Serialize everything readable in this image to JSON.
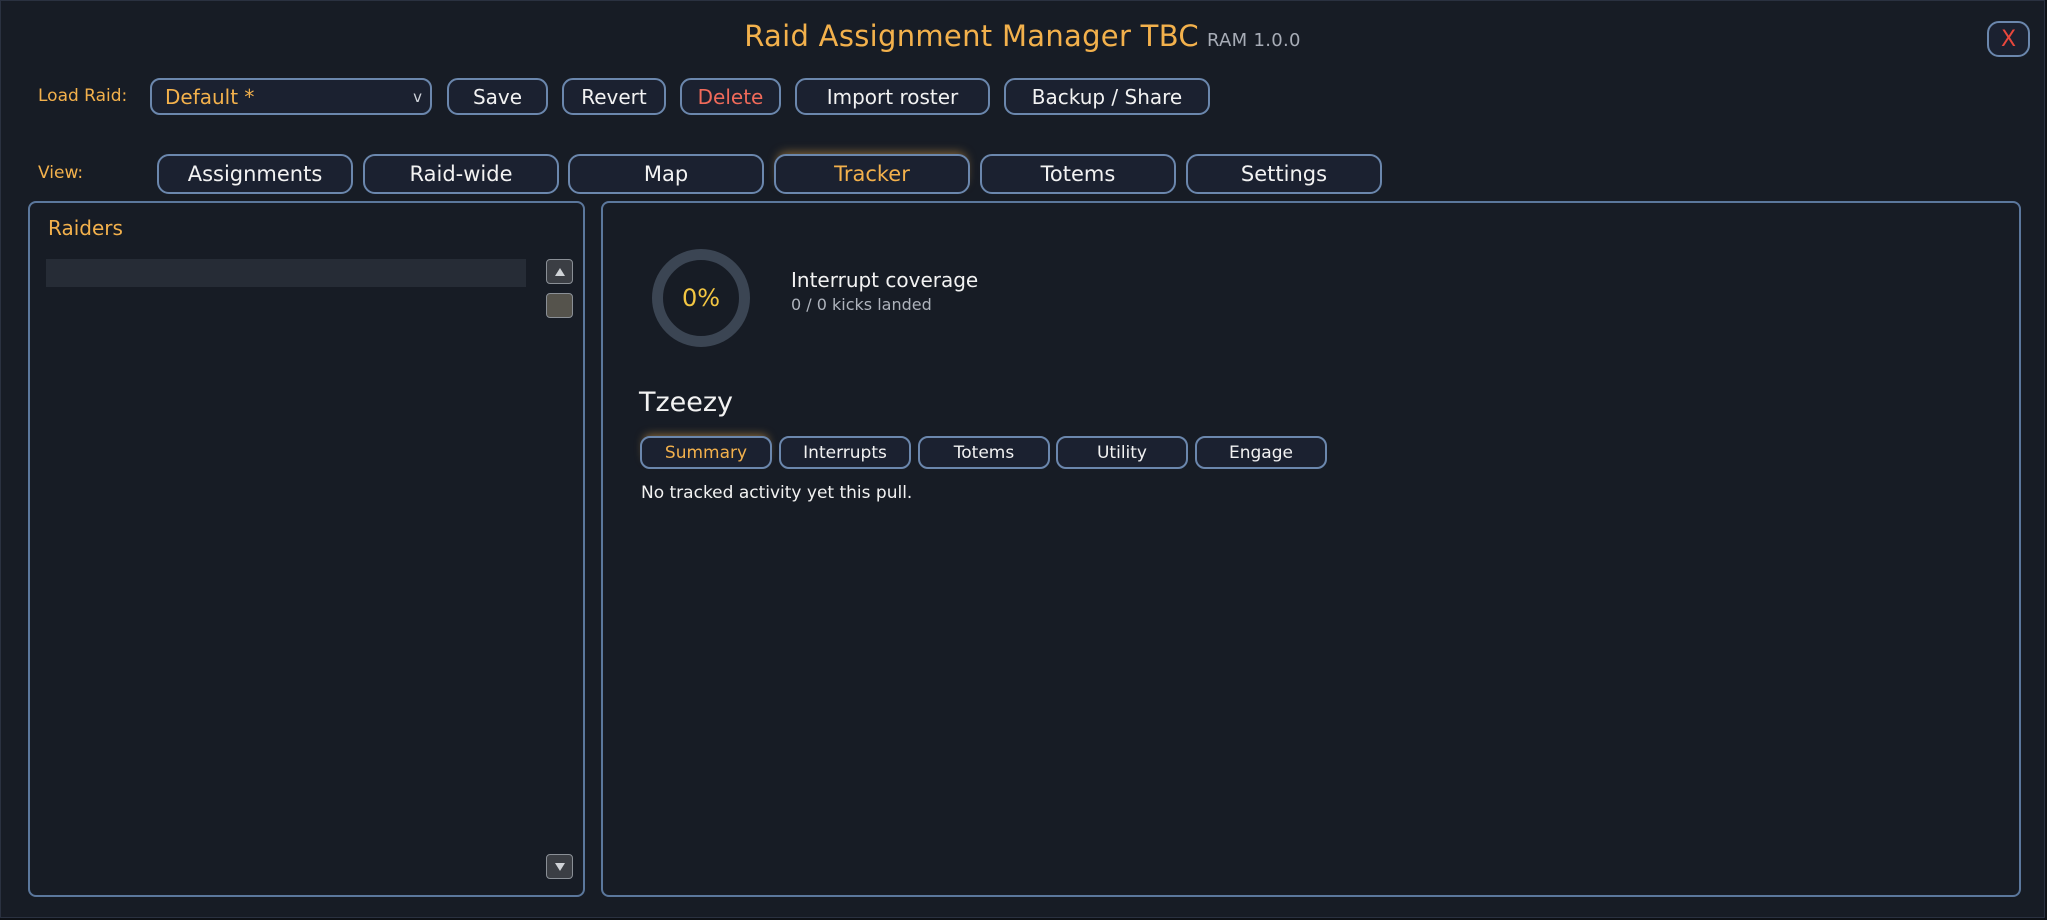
{
  "window": {
    "title": "Raid Assignment Manager TBC",
    "version": "RAM 1.0.0",
    "close_label": "X"
  },
  "toolbar": {
    "load_raid_label": "Load Raid:",
    "selected_raid": "Default *",
    "dropdown_arrow": "v",
    "save_label": "Save",
    "revert_label": "Revert",
    "delete_label": "Delete",
    "import_label": "Import roster",
    "backup_label": "Backup / Share"
  },
  "view": {
    "label": "View:",
    "tabs": [
      {
        "label": "Assignments"
      },
      {
        "label": "Raid-wide"
      },
      {
        "label": "Map"
      },
      {
        "label": "Tracker"
      },
      {
        "label": "Totems"
      },
      {
        "label": "Settings"
      }
    ],
    "active_tab": "Tracker"
  },
  "raiders": {
    "title": "Raiders",
    "search_value": "",
    "icons": {
      "scroll_up": "chevron-up-icon",
      "scroll_thumb": "scroll-thumb",
      "scroll_down": "chevron-down-icon"
    }
  },
  "tracker": {
    "coverage_percent": "0%",
    "coverage_title": "Interrupt coverage",
    "coverage_sub": "0 / 0 kicks landed",
    "player_name": "Tzeezy",
    "subtabs": [
      {
        "label": "Summary"
      },
      {
        "label": "Interrupts"
      },
      {
        "label": "Totems"
      },
      {
        "label": "Utility"
      },
      {
        "label": "Engage"
      }
    ],
    "active_subtab": "Summary",
    "empty_message": "No tracked activity yet this pull."
  },
  "colors": {
    "accent": "#f3b14c",
    "border": "#6b87ad",
    "background": "#171c25",
    "danger": "#f06a5a",
    "ring_value": "#f3c642"
  }
}
